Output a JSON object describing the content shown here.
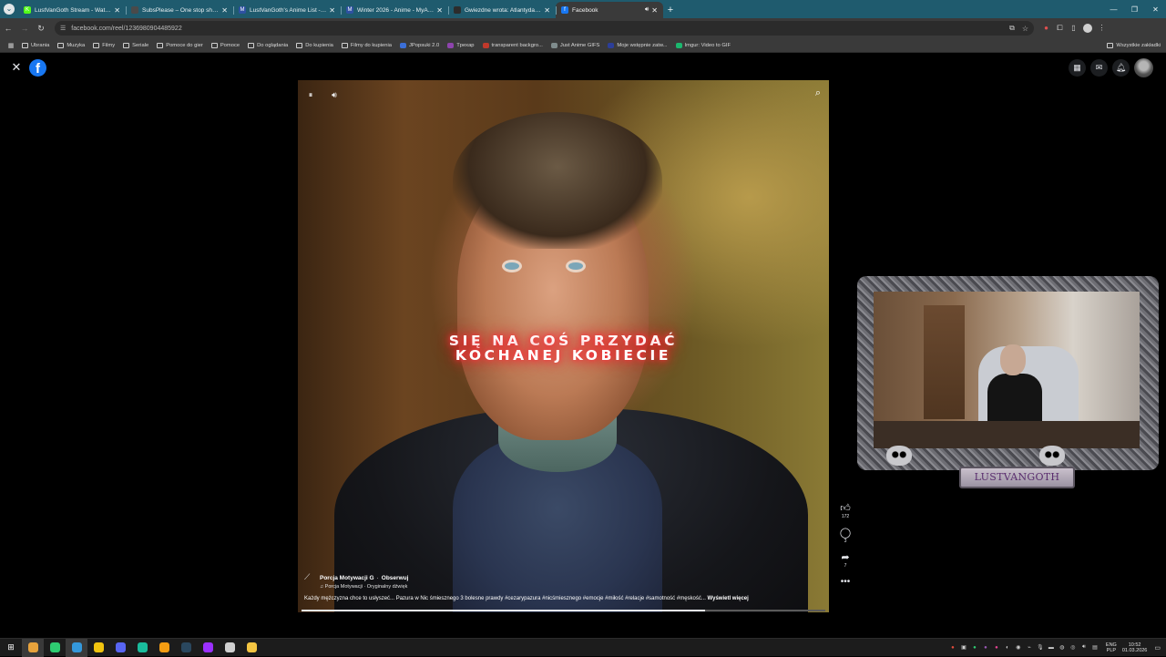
{
  "browser": {
    "tabs": [
      {
        "title": "LustVanGoth Stream - Watch Li",
        "favicon_color": "#53fc18",
        "favicon_glyph": "K",
        "active": false,
        "audio": false
      },
      {
        "title": "SubsPlease – One stop shop fo",
        "favicon_color": "#4a4a4a",
        "favicon_glyph": "",
        "active": false,
        "audio": false
      },
      {
        "title": "LustVanGoth's Anime List - My",
        "favicon_color": "#2e51a2",
        "favicon_glyph": "M",
        "active": false,
        "audio": false
      },
      {
        "title": "Winter 2026 - Anime - MyAnim",
        "favicon_color": "#2e51a2",
        "favicon_glyph": "M",
        "active": false,
        "audio": false
      },
      {
        "title": "Gwiezdne wrota: Atlantyda / St",
        "favicon_color": "#2c2c2c",
        "favicon_glyph": "",
        "active": false,
        "audio": false
      },
      {
        "title": "Facebook",
        "favicon_color": "#1877f2",
        "favicon_glyph": "f",
        "active": true,
        "audio": true
      }
    ],
    "url": "facebook.com/reel/1236980904485922",
    "bookmarks": [
      {
        "label": "Ubrania",
        "type": "folder"
      },
      {
        "label": "Muzyka",
        "type": "folder"
      },
      {
        "label": "Filmy",
        "type": "folder"
      },
      {
        "label": "Seriale",
        "type": "folder"
      },
      {
        "label": "Pomoce do gier",
        "type": "folder"
      },
      {
        "label": "Pomoce",
        "type": "folder"
      },
      {
        "label": "Do oglądania",
        "type": "folder"
      },
      {
        "label": "Do kupienia",
        "type": "folder"
      },
      {
        "label": "Filmy do kupienia",
        "type": "folder"
      },
      {
        "label": "JPopsuki 2.0",
        "type": "site",
        "color": "#3b6fd8"
      },
      {
        "label": "Tpexap",
        "type": "site",
        "color": "#8e44ad"
      },
      {
        "label": "transparent backgro...",
        "type": "site",
        "color": "#c0392b"
      },
      {
        "label": "Just Anime GIFS",
        "type": "site",
        "color": "#7f8c8d"
      },
      {
        "label": "Moje wstępnie zatw...",
        "type": "site",
        "color": "#2c3e99"
      },
      {
        "label": "Imgur: Video to GIF",
        "type": "site",
        "color": "#1bb76e"
      }
    ],
    "bookmarks_right": "Wszystkie zakładki"
  },
  "reel": {
    "caption_line1": "SIĘ NA COŚ PRZYDAĆ",
    "caption_line2": "KOCHANEJ KOBIECIE",
    "author": "Porcja Motywacji G",
    "follow_label": "Obserwuj",
    "audio_line": "Porcja Motywacji · Oryginalny dźwięk",
    "description": "Każdy mężczyzna chce to usłyszeć... Pazura w Nic śmiesznego 3 bolesne prawdy #cezarypazura #nicśmiesznego #emocje #miłość #relacje #samotność #męskość...",
    "more_label": "Wyświetl więcej",
    "progress": 0.77,
    "likes": "172",
    "comments": "3",
    "shares": "7"
  },
  "overlay": {
    "streamer_label": "LUSTVANGOTH"
  },
  "taskbar": {
    "apps": [
      {
        "name": "chrome",
        "color": "#e8a33c",
        "active": true
      },
      {
        "name": "app-green",
        "color": "#2ecc71",
        "active": false
      },
      {
        "name": "app-blue",
        "color": "#3498db",
        "active": true
      },
      {
        "name": "app-yellow",
        "color": "#f1c40f",
        "active": false
      },
      {
        "name": "discord",
        "color": "#5865f2",
        "active": false
      },
      {
        "name": "app-cyan",
        "color": "#1abc9c",
        "active": false
      },
      {
        "name": "vlc",
        "color": "#f39c12",
        "active": false
      },
      {
        "name": "steam",
        "color": "#2a475e",
        "active": false
      },
      {
        "name": "app-purple",
        "color": "#9b30ff",
        "active": false
      },
      {
        "name": "obs",
        "color": "#d0d0d0",
        "active": false
      },
      {
        "name": "explorer",
        "color": "#f4c542",
        "active": false
      }
    ],
    "lang_top": "ENG",
    "lang_bottom": "PLP",
    "time": "10:52",
    "date": "01.03.2026"
  },
  "colors": {
    "fb_blue": "#1877f2",
    "tab_strip": "#1f5b6e",
    "caption_glow": "#ff3040"
  }
}
